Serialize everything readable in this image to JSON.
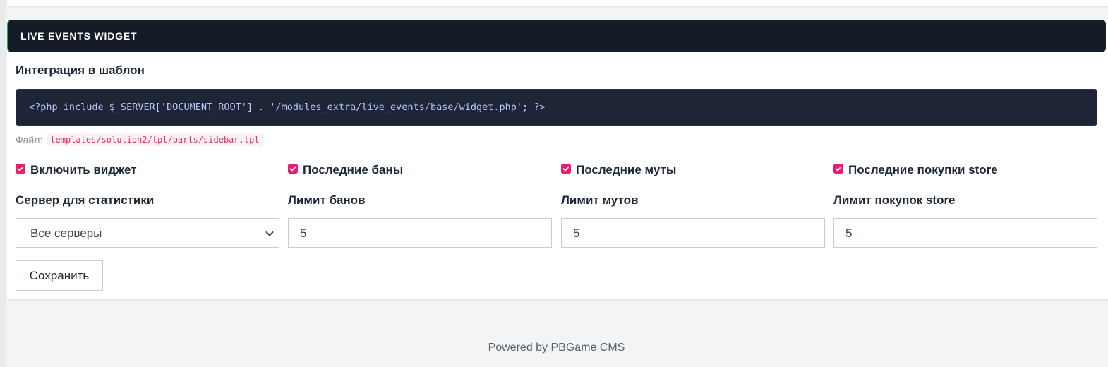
{
  "card": {
    "title": "LIVE EVENTS WIDGET",
    "integration_title": "Интеграция в шаблон",
    "code": "<?php include $_SERVER['DOCUMENT_ROOT'] . '/modules_extra/live_events/base/widget.php'; ?>",
    "file_label": "Файл:",
    "file_path": "templates/solution2/tpl/parts/sidebar.tpl"
  },
  "checkboxes": [
    {
      "label": "Включить виджет",
      "checked": true
    },
    {
      "label": "Последние баны",
      "checked": true
    },
    {
      "label": "Последние муты",
      "checked": true
    },
    {
      "label": "Последние покупки store",
      "checked": true
    }
  ],
  "fields": {
    "server": {
      "label": "Сервер для статистики",
      "value": "Все серверы"
    },
    "bans_limit": {
      "label": "Лимит банов",
      "value": "5"
    },
    "mutes_limit": {
      "label": "Лимит мутов",
      "value": "5"
    },
    "store_limit": {
      "label": "Лимит покупок store",
      "value": "5"
    }
  },
  "save_label": "Сохранить",
  "footer": "Powered by PBGame CMS",
  "colors": {
    "header_bg": "#161c27",
    "header_accent": "#2fa866",
    "checkbox": "#e51f6f",
    "code_bg": "#1e2536",
    "code_text": "#b9c7ff"
  }
}
